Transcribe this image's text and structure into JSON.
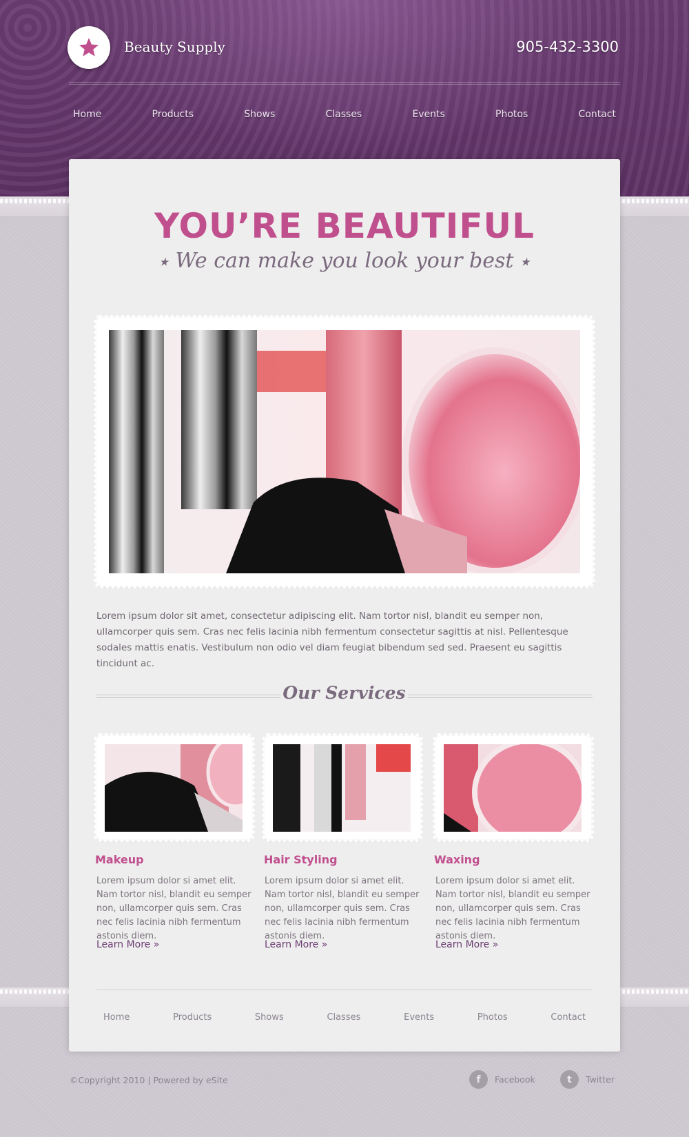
{
  "header": {
    "brand": "Beauty Supply",
    "phone": "905-432-3300",
    "logo_icon": "star-icon",
    "accent": "#c04f8e",
    "band_color": "#5d3264"
  },
  "nav": {
    "items": [
      {
        "label": "Home"
      },
      {
        "label": "Products"
      },
      {
        "label": "Shows"
      },
      {
        "label": "Classes"
      },
      {
        "label": "Events"
      },
      {
        "label": "Photos"
      },
      {
        "label": "Contact"
      }
    ]
  },
  "hero": {
    "title": "YOU’RE BEAUTIFUL",
    "subtitle": "We can make you look your best",
    "star_left": "★",
    "star_right": "★"
  },
  "intro": {
    "text": "Lorem ipsum dolor sit amet, consectetur adipiscing elit. Nam tortor nisl, blandit eu semper non, ullamcorper quis sem. Cras nec felis lacinia nibh fermentum consectetur sagittis at nisl. Pellentesque sodales mattis enatis. Vestibulum non odio vel diam feugiat bibendum sed sed. Praesent eu  sagittis tincidunt ac."
  },
  "services": {
    "heading": "Our Services",
    "items": [
      {
        "title": "Makeup",
        "description": "Lorem ipsum dolor si amet elit. Nam tortor nisl, blandit eu semper non, ullamcorper quis sem. Cras nec felis lacinia nibh fermentum astonis diem.",
        "link": "Learn More »"
      },
      {
        "title": "Hair Styling",
        "description": "Lorem ipsum dolor si amet elit. Nam tortor nisl, blandit eu semper non, ullamcorper quis sem. Cras nec felis lacinia nibh fermentum astonis diem.",
        "link": "Learn More »"
      },
      {
        "title": "Waxing",
        "description": "Lorem ipsum dolor si amet elit. Nam tortor nisl, blandit eu semper non, ullamcorper quis sem. Cras nec felis lacinia nibh fermentum astonis diem.",
        "link": "Learn More »"
      }
    ]
  },
  "footer": {
    "nav": [
      {
        "label": "Home"
      },
      {
        "label": "Products"
      },
      {
        "label": "Shows"
      },
      {
        "label": "Classes"
      },
      {
        "label": "Events"
      },
      {
        "label": "Photos"
      },
      {
        "label": "Contact"
      }
    ],
    "copyright": "©Copyright 2010 | Powered by eSite",
    "social": [
      {
        "label": "Facebook",
        "icon": "facebook-icon",
        "glyph": "f"
      },
      {
        "label": "Twitter",
        "icon": "twitter-icon",
        "glyph": "t"
      }
    ]
  }
}
